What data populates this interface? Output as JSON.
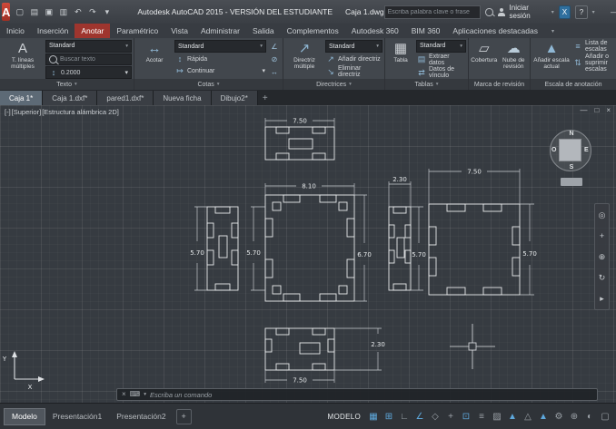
{
  "icons": {
    "caret": "▾",
    "close": "×",
    "minimize": "—",
    "restore": "□",
    "app_logo": "A",
    "keyboard": "⌨",
    "plus": "+",
    "minus": "−",
    "mtext": "A",
    "text_height": "↕",
    "dim_linear": "↔",
    "dim_quick": "↕",
    "dim_continue": "↦",
    "leader": "↗",
    "leader_add": "↗",
    "leader_remove": "↘",
    "table": "▦",
    "extract": "▤",
    "datalink": "⇄",
    "wipeout": "▱",
    "revcloud": "☁",
    "scale_triangle": "▲",
    "scale_list": "≡",
    "scale_addremove": "⇅",
    "angle": "∠",
    "diameter": "⊘"
  },
  "titlebar": {
    "app_title": "Autodesk AutoCAD 2015 - VERSIÓN DEL ESTUDIANTE",
    "doc_title": "Caja 1.dwg",
    "search_placeholder": "Escriba palabra clave o frase",
    "signin": "Iniciar sesión",
    "exchange": "X",
    "help": "?"
  },
  "quick_access": [
    {
      "name": "new-file-icon",
      "glyph": "▢"
    },
    {
      "name": "open-file-icon",
      "glyph": "▤"
    },
    {
      "name": "save-icon",
      "glyph": "▣"
    },
    {
      "name": "plot-icon",
      "glyph": "▥"
    },
    {
      "name": "undo-icon",
      "glyph": "↶"
    },
    {
      "name": "redo-icon",
      "glyph": "↷"
    },
    {
      "name": "quick-access-caret-icon",
      "glyph": "▾"
    }
  ],
  "ribbon": {
    "tabs": [
      {
        "label": "Inicio",
        "active": false
      },
      {
        "label": "Inserción",
        "active": false
      },
      {
        "label": "Anotar",
        "active": true
      },
      {
        "label": "Paramétrico",
        "active": false
      },
      {
        "label": "Vista",
        "active": false
      },
      {
        "label": "Administrar",
        "active": false
      },
      {
        "label": "Salida",
        "active": false
      },
      {
        "label": "Complementos",
        "active": false
      },
      {
        "label": "Autodesk 360",
        "active": false
      },
      {
        "label": "BIM 360",
        "active": false
      },
      {
        "label": "Aplicaciones destacadas",
        "active": false
      }
    ],
    "panels": {
      "texto": {
        "label": "Texto",
        "big_button": "T. líneas múltiples",
        "style": "Standard",
        "search_placeholder": "Buscar texto",
        "text_height": "0.2000"
      },
      "cotas": {
        "label": "Cotas",
        "big_button": "Acotar",
        "style": "Standard",
        "quick": "Rápida",
        "continue": "Continuar"
      },
      "directrices": {
        "label": "Directrices",
        "big_button": "Directriz múltiple",
        "style": "Standard",
        "add": "Añadir directriz",
        "remove": "Eliminar directriz"
      },
      "tablas": {
        "label": "Tablas",
        "big_button": "Tabla",
        "style": "Standard",
        "extract": "Extraer datos",
        "link": "Datos de vínculo"
      },
      "marcas": {
        "label": "Marca de revisión",
        "wipeout": "Cobertura",
        "revcloud": "Nube de revisión"
      },
      "escala": {
        "label": "Escala de anotación",
        "add_current": "Añadir escala actual",
        "scale_list": "Lista de escalas",
        "add_remove": "Añadir o suprimir escalas"
      }
    }
  },
  "file_tabs": [
    {
      "label": "Caja 1*",
      "active": true
    },
    {
      "label": "Caja 1.dxf*",
      "active": false
    },
    {
      "label": "pared1.dxf*",
      "active": false
    },
    {
      "label": "Nueva ficha",
      "active": false
    },
    {
      "label": "Dibujo2*",
      "active": false
    }
  ],
  "viewport": {
    "controls": [
      "[-]",
      "[Superior]",
      "[Estructura alámbrica 2D]"
    ]
  },
  "viewcube": {
    "north": "N",
    "east": "E",
    "south": "S",
    "west": "O"
  },
  "navbar_icons": [
    {
      "name": "steering-wheel-icon",
      "glyph": "◎"
    },
    {
      "name": "pan-icon",
      "glyph": "+"
    },
    {
      "name": "zoom-icon",
      "glyph": "⊕"
    },
    {
      "name": "orbit-icon",
      "glyph": "↻"
    },
    {
      "name": "show-motion-icon",
      "glyph": "▸"
    }
  ],
  "drawing": {
    "dims": {
      "top_width": "7.50",
      "center_width": "8.10",
      "small_width": "2.30",
      "right_width": "7.50",
      "left_height": "5.70",
      "center_left_height": "5.70",
      "center_right_height": "6.70",
      "small_height": "5.70",
      "right_height": "5.70",
      "bottom_height": "2.30",
      "bottom_width": "7.50"
    },
    "axis_x": "X",
    "axis_y": "Y"
  },
  "command_line": {
    "prompt": "Escriba un comando"
  },
  "statusbar": {
    "mode_label": "MODELO",
    "layout_tabs": [
      {
        "label": "Modelo",
        "active": true
      },
      {
        "label": "Presentación1",
        "active": false
      },
      {
        "label": "Presentación2",
        "active": false
      }
    ],
    "icons": [
      {
        "name": "grid-icon",
        "glyph": "▦",
        "color": "#5ea8dc"
      },
      {
        "name": "snap-icon",
        "glyph": "⊞",
        "color": "#5ea8dc"
      },
      {
        "name": "ortho-icon",
        "glyph": "∟",
        "color": "#9aa0a6"
      },
      {
        "name": "polar-tracking-icon",
        "glyph": "∠",
        "color": "#5ea8dc"
      },
      {
        "name": "isodraft-icon",
        "glyph": "◇",
        "color": "#9aa0a6"
      },
      {
        "name": "object-snap-tracking-icon",
        "glyph": "+",
        "color": "#9aa0a6"
      },
      {
        "name": "object-snap-icon",
        "glyph": "⊡",
        "color": "#5ea8dc"
      },
      {
        "name": "lineweight-icon",
        "glyph": "≡",
        "color": "#9aa0a6"
      },
      {
        "name": "transparency-icon",
        "glyph": "▨",
        "color": "#9aa0a6"
      },
      {
        "name": "annotation-visibility-icon",
        "glyph": "▲",
        "color": "#5ea8dc"
      },
      {
        "name": "autoscale-icon",
        "glyph": "△",
        "color": "#9aa0a6"
      },
      {
        "name": "annotation-scale-icon",
        "glyph": "▲",
        "color": "#5ea8dc"
      },
      {
        "name": "workspace-gear-icon",
        "glyph": "⚙",
        "color": "#9aa0a6"
      },
      {
        "name": "annotation-monitor-icon",
        "glyph": "⊕",
        "color": "#9aa0a6"
      },
      {
        "name": "isolate-objects-icon",
        "glyph": "◐",
        "color": "#9aa0a6"
      },
      {
        "name": "clean-screen-icon",
        "glyph": "▢",
        "color": "#9aa0a6"
      }
    ]
  }
}
